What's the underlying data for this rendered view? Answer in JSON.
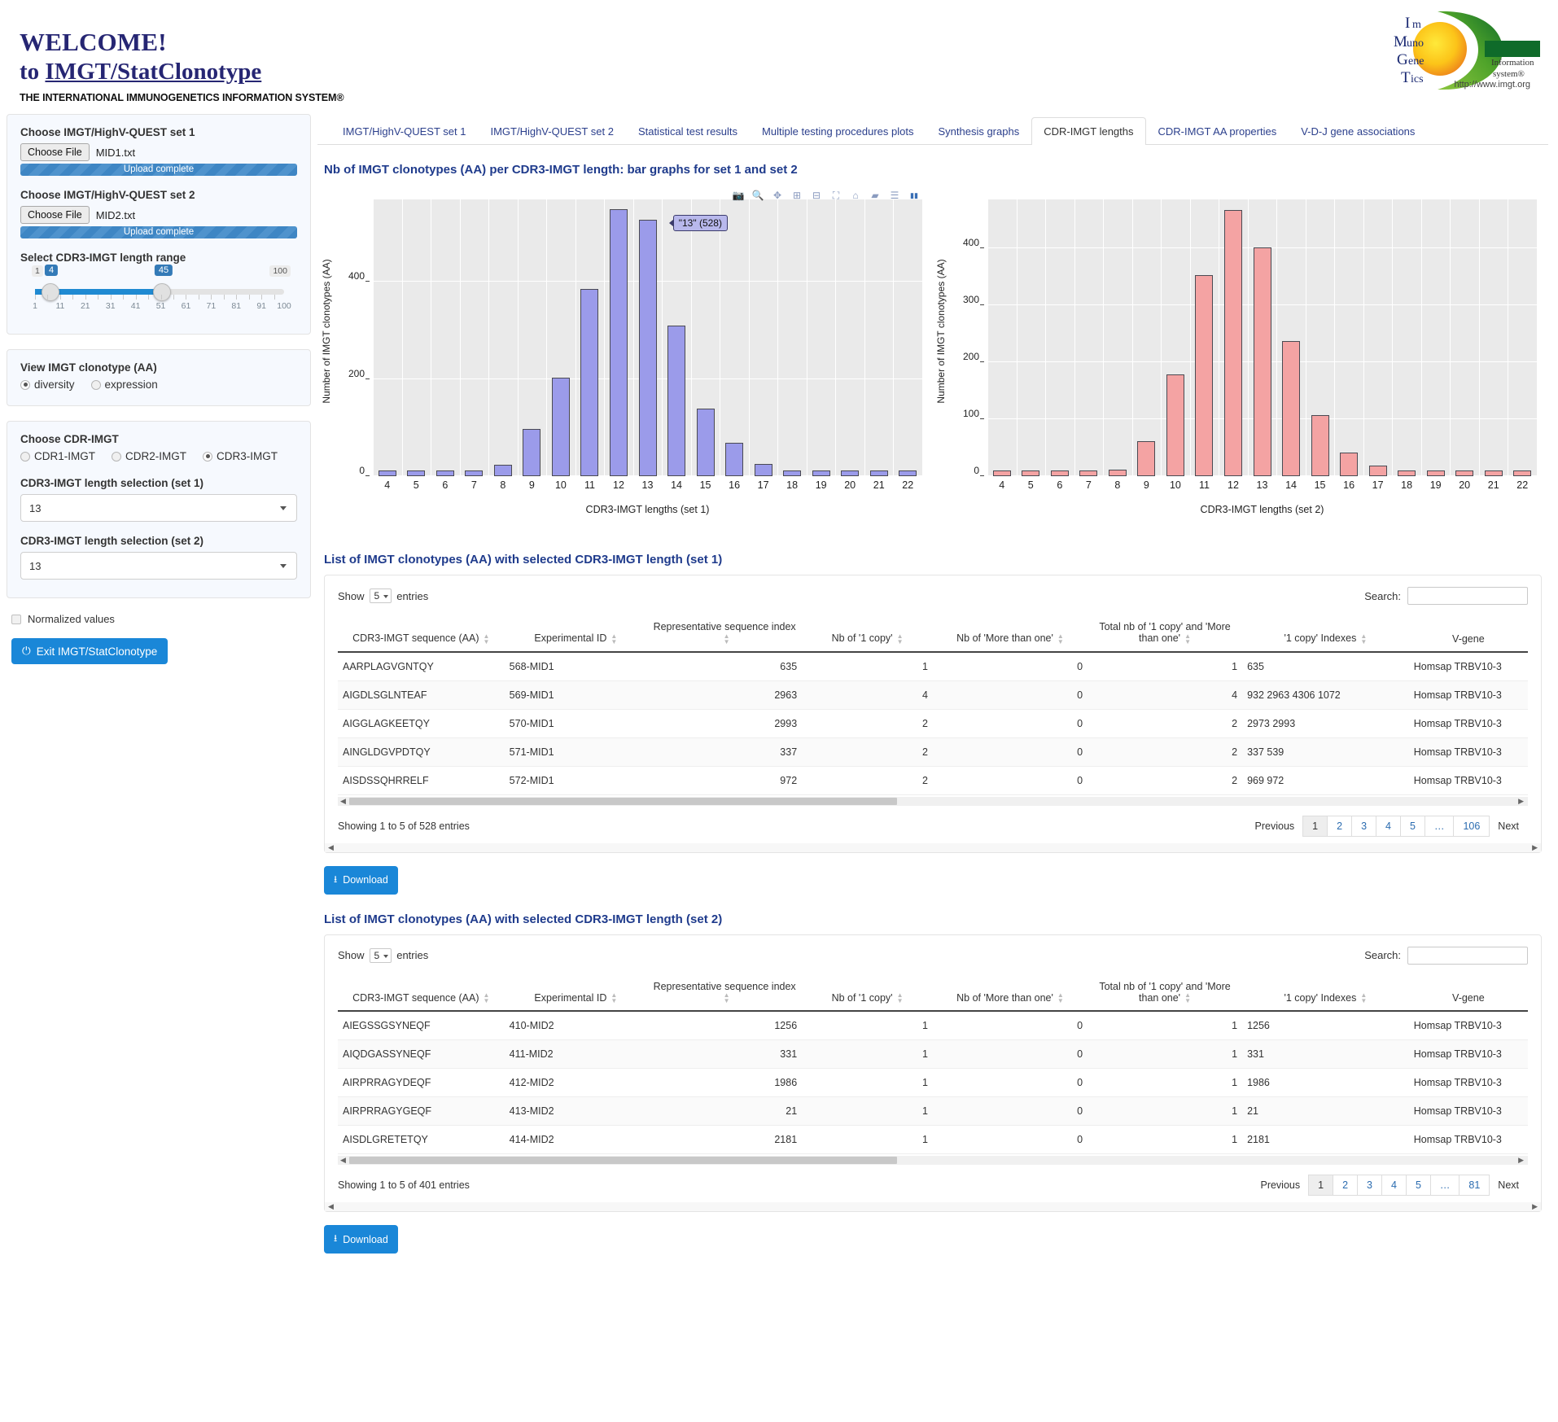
{
  "header": {
    "welcome": "WELCOME!",
    "to_text": "to ",
    "app_name": "IMGT/StatClonotype",
    "subtitle": "THE INTERNATIONAL IMMUNOGENETICS INFORMATION SYSTEM®",
    "logo_lines": [
      "Im",
      "Muno",
      "Gene",
      "Tics"
    ],
    "logo_sub1": "Information",
    "logo_sub2": "system®",
    "logo_url": "http://www.imgt.org"
  },
  "sidebar": {
    "set1_label": "Choose IMGT/HighV-QUEST set 1",
    "set1_button": "Choose File",
    "set1_file": "MID1.txt",
    "set1_progress": "Upload complete",
    "set2_label": "Choose IMGT/HighV-QUEST set 2",
    "set2_button": "Choose File",
    "set2_file": "MID2.txt",
    "set2_progress": "Upload complete",
    "range_label": "Select CDR3-IMGT length range",
    "range_min": "1",
    "range_max": "100",
    "range_low": "4",
    "range_high": "45",
    "range_ticks": [
      "1",
      "11",
      "21",
      "31",
      "41",
      "51",
      "61",
      "71",
      "81",
      "91",
      "100"
    ],
    "view_label": "View IMGT clonotype (AA)",
    "view_options": [
      "diversity",
      "expression"
    ],
    "view_selected": "diversity",
    "cdr_label": "Choose CDR-IMGT",
    "cdr_options": [
      "CDR1-IMGT",
      "CDR2-IMGT",
      "CDR3-IMGT"
    ],
    "cdr_selected": "CDR3-IMGT",
    "len1_label": "CDR3-IMGT length selection (set 1)",
    "len1_value": "13",
    "len2_label": "CDR3-IMGT length selection (set 2)",
    "len2_value": "13",
    "normalized_label": "Normalized values",
    "exit_label": "Exit IMGT/StatClonotype"
  },
  "tabs": {
    "items": [
      "IMGT/HighV-QUEST set 1",
      "IMGT/HighV-QUEST set 2",
      "Statistical test results",
      "Multiple testing procedures plots",
      "Synthesis graphs",
      "CDR-IMGT lengths",
      "CDR-IMGT AA properties",
      "V-D-J gene associations"
    ],
    "active": "CDR-IMGT lengths"
  },
  "charts_title": "Nb of IMGT clonotypes (AA) per CDR3-IMGT length: bar graphs for set 1 and set 2",
  "modebar": [
    "camera-icon",
    "zoom-icon",
    "pan-icon",
    "zoom-in-icon",
    "zoom-out-icon",
    "autoscale-icon",
    "reset-axes-icon",
    "hover-closest-icon",
    "hover-compare-icon",
    "plotly-logo-icon"
  ],
  "chart_data": [
    {
      "type": "bar",
      "title": "",
      "xlabel": "CDR3-IMGT lengths (set 1)",
      "ylabel": "Number of IMGT clonotypes (AA)",
      "categories": [
        "4",
        "5",
        "6",
        "7",
        "8",
        "9",
        "10",
        "11",
        "12",
        "13",
        "14",
        "15",
        "16",
        "17",
        "18",
        "19",
        "20",
        "21",
        "22"
      ],
      "values": [
        3,
        0,
        5,
        0,
        23,
        97,
        203,
        385,
        550,
        528,
        310,
        140,
        68,
        26,
        5,
        4,
        2,
        0,
        2
      ],
      "ytick_labels": [
        "0",
        "200",
        "400"
      ],
      "ytick_values": [
        0,
        200,
        400
      ],
      "ylim": [
        0,
        570
      ],
      "grid": true,
      "color": "#9b9bea",
      "tooltip": "\"13\" (528)"
    },
    {
      "type": "bar",
      "title": "",
      "xlabel": "CDR3-IMGT lengths (set 2)",
      "ylabel": "Number of IMGT clonotypes (AA)",
      "categories": [
        "4",
        "5",
        "6",
        "7",
        "8",
        "9",
        "10",
        "11",
        "12",
        "13",
        "14",
        "15",
        "16",
        "17",
        "18",
        "19",
        "20",
        "21",
        "22"
      ],
      "values": [
        0,
        0,
        0,
        2,
        11,
        62,
        178,
        353,
        467,
        401,
        237,
        107,
        41,
        18,
        5,
        1,
        0,
        0,
        0
      ],
      "ytick_labels": [
        "0",
        "100",
        "200",
        "300",
        "400"
      ],
      "ytick_values": [
        0,
        100,
        200,
        300,
        400
      ],
      "ylim": [
        0,
        485
      ],
      "grid": true,
      "color": "#f4a3a3",
      "tooltip": ""
    }
  ],
  "table1": {
    "title": "List of IMGT clonotypes (AA) with selected CDR3-IMGT length (set 1)",
    "show_label": "Show",
    "show_value": "5",
    "entries_label": "entries",
    "search_label": "Search:",
    "search_value": "",
    "columns": [
      "CDR3-IMGT sequence (AA)",
      "Experimental ID",
      "Representative sequence index",
      "Nb of '1 copy'",
      "Nb of 'More than one'",
      "Total nb of '1 copy' and 'More than one'",
      "'1 copy' Indexes",
      "V-gene"
    ],
    "rows": [
      [
        "AARPLAGVGNTQY",
        "568-MID1",
        "635",
        "1",
        "0",
        "1",
        "635",
        "Homsap TRBV10-3"
      ],
      [
        "AIGDLSGLNTEAF",
        "569-MID1",
        "2963",
        "4",
        "0",
        "4",
        "932 2963 4306 1072",
        "Homsap TRBV10-3"
      ],
      [
        "AIGGLAGKEETQY",
        "570-MID1",
        "2993",
        "2",
        "0",
        "2",
        "2973 2993",
        "Homsap TRBV10-3"
      ],
      [
        "AINGLDGVPDTQY",
        "571-MID1",
        "337",
        "2",
        "0",
        "2",
        "337 539",
        "Homsap TRBV10-3"
      ],
      [
        "AISDSSQHRRELF",
        "572-MID1",
        "972",
        "2",
        "0",
        "2",
        "969 972",
        "Homsap TRBV10-3"
      ]
    ],
    "info": "Showing 1 to 5 of 528 entries",
    "previous": "Previous",
    "next": "Next",
    "pages": [
      "1",
      "2",
      "3",
      "4",
      "5",
      "…",
      "106"
    ],
    "active_page": "1",
    "download": "Download"
  },
  "table2": {
    "title": "List of IMGT clonotypes (AA) with selected CDR3-IMGT length (set 2)",
    "show_label": "Show",
    "show_value": "5",
    "entries_label": "entries",
    "search_label": "Search:",
    "search_value": "",
    "columns": [
      "CDR3-IMGT sequence (AA)",
      "Experimental ID",
      "Representative sequence index",
      "Nb of '1 copy'",
      "Nb of 'More than one'",
      "Total nb of '1 copy' and 'More than one'",
      "'1 copy' Indexes",
      "V-gene"
    ],
    "rows": [
      [
        "AIEGSSGSYNEQF",
        "410-MID2",
        "1256",
        "1",
        "0",
        "1",
        "1256",
        "Homsap TRBV10-3"
      ],
      [
        "AIQDGASSYNEQF",
        "411-MID2",
        "331",
        "1",
        "0",
        "1",
        "331",
        "Homsap TRBV10-3"
      ],
      [
        "AIRPRRAGYDEQF",
        "412-MID2",
        "1986",
        "1",
        "0",
        "1",
        "1986",
        "Homsap TRBV10-3"
      ],
      [
        "AIRPRRAGYGEQF",
        "413-MID2",
        "21",
        "1",
        "0",
        "1",
        "21",
        "Homsap TRBV10-3"
      ],
      [
        "AISDLGRETETQY",
        "414-MID2",
        "2181",
        "1",
        "0",
        "1",
        "2181",
        "Homsap TRBV10-3"
      ]
    ],
    "info": "Showing 1 to 5 of 401 entries",
    "previous": "Previous",
    "next": "Next",
    "pages": [
      "1",
      "2",
      "3",
      "4",
      "5",
      "…",
      "81"
    ],
    "active_page": "1",
    "download": "Download"
  },
  "colors": {
    "brand_blue": "#1a87d8",
    "title_blue": "#1f3b8c",
    "set1_bar": "#9b9bea",
    "set2_bar": "#f4a3a3"
  }
}
